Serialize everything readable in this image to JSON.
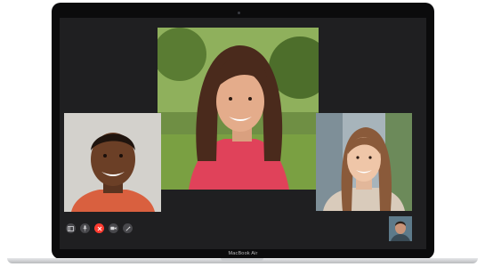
{
  "device": {
    "model_label": "MacBook Air"
  },
  "facetime": {
    "participants": [
      "participant-left",
      "participant-center",
      "participant-right"
    ],
    "self_view": "self-view",
    "controls": [
      "sidebar-icon",
      "mute-mic-icon",
      "end-call-icon",
      "camera-toggle-icon",
      "effects-icon"
    ]
  },
  "colors": {
    "screen_background": "#1f1f21",
    "end_call": "#ff3b30",
    "control_button": "#48484c"
  }
}
